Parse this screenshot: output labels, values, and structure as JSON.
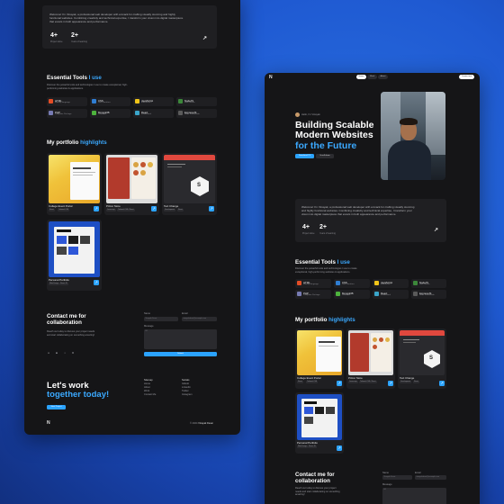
{
  "brand": {
    "logo_icon": "n-logo-icon"
  },
  "nav": {
    "items": [
      "Home",
      "Work",
      "About"
    ],
    "cta": "Contact me"
  },
  "hero": {
    "greeting": "Hello, I'm Vinayak",
    "title_line1": "Building Scalable",
    "title_line2": "Modern Websites",
    "title_line3": "for the Future",
    "primary_btn": "Download CV",
    "secondary_btn": "Scroll down"
  },
  "about": {
    "text": "Welcome! I'm Vinayak, a professional web developer with a knack for crafting visually stunning and highly functional websites. Combining creativity and technical expertise, I transform your vision into digital masterpiece that excels in both appearance and performance.",
    "stats": [
      {
        "value": "4+",
        "label": "Project done"
      },
      {
        "value": "2+",
        "label": "Years of learning"
      }
    ]
  },
  "tools": {
    "title_prefix": "Essential Tools ",
    "title_accent": "I use",
    "subtitle": "Discover the powerful tools and technologies I use to create exceptional, high-performing websites & applications.",
    "items": [
      {
        "name": "HTML",
        "desc": "Markup language",
        "color": "#e44d26"
      },
      {
        "name": "CSS",
        "desc": "User Interface",
        "color": "#2f7dd2"
      },
      {
        "name": "JavaScript",
        "desc": "Interaction",
        "color": "#f0c419"
      },
      {
        "name": "NodeJS",
        "desc": "Web Server",
        "color": "#3c873a"
      },
      {
        "name": "PHP",
        "desc": "Complete Package",
        "color": "#777bb3"
      },
      {
        "name": "MongoDB",
        "desc": "Database",
        "color": "#4db33d"
      },
      {
        "name": "React",
        "desc": "Framework",
        "color": "#3aa5c9"
      },
      {
        "name": "ExpressJS",
        "desc": "Node Framework",
        "color": "#5a5a5a"
      }
    ]
  },
  "portfolio": {
    "title_prefix": "My portfolio ",
    "title_accent": "highlights",
    "projects": [
      {
        "title": "College Event Portal",
        "tags": [
          "React",
          "Tailwind CSS"
        ]
      },
      {
        "title": "Pizzer Store",
        "tags": [
          "Javascript",
          "Tailwind CSS / React"
        ]
      },
      {
        "title": "Text Change",
        "tags": [
          "Development",
          "React"
        ]
      },
      {
        "title": "Personal Portfolio",
        "tags": [
          "Web Design",
          "React JS"
        ]
      }
    ]
  },
  "contact": {
    "title_line1": "Contact me for",
    "title_line2": "collaboration",
    "desc": "Reach out today to discuss your project needs and start collaborating on something amazing!",
    "name_label": "Name",
    "name_placeholder": "Vinayak Desai",
    "email_label": "Email",
    "email_placeholder": "vinayakdesai@example.com",
    "message_label": "Message",
    "message_placeholder": "Hi!",
    "submit": "Submit",
    "socials": [
      "github-icon",
      "linkedin-icon",
      "twitter-icon",
      "instagram-icon"
    ]
  },
  "footer": {
    "title_line1": "Let's work",
    "title_line2": "together today!",
    "cta": "Start Project",
    "sitemap_title": "Sitemap",
    "sitemap": [
      "Home",
      "About",
      "Work",
      "Contact Me"
    ],
    "socials_title": "Socials",
    "socials": [
      "GitHub",
      "LinkedIn",
      "Twitter",
      "Instagram"
    ],
    "copyright_prefix": "© 2024",
    "copyright_name": "Vinayak Desai"
  },
  "colors": {
    "accent": "#3ba9ff",
    "button": "#2ba3ff",
    "background": "#151517",
    "card": "#1f1f22"
  }
}
